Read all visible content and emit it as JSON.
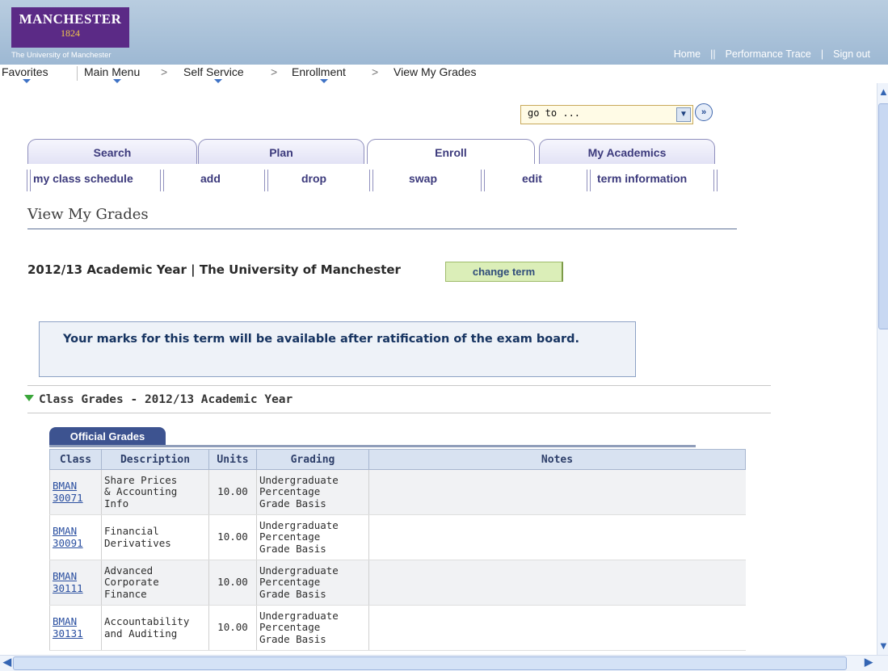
{
  "header": {
    "logo_name": "MANCHESTER",
    "logo_year": "1824",
    "logo_sub": "The University of Manchester",
    "links": [
      "Home",
      "Performance Trace",
      "Sign out"
    ]
  },
  "nav": {
    "items": [
      "Favorites",
      "Main Menu",
      "Self Service",
      "Enrollment",
      "View My Grades"
    ]
  },
  "goto": {
    "value": "go to ..."
  },
  "tabs": [
    "Search",
    "Plan",
    "Enroll",
    "My Academics"
  ],
  "active_tab": "Enroll",
  "subtabs": [
    "my class schedule",
    "add",
    "drop",
    "swap",
    "edit",
    "term information"
  ],
  "page": {
    "title": "View My Grades",
    "term": "2012/13 Academic Year | The University of Manchester",
    "change_term": "change term",
    "notice": "Your marks for this term will be available after ratification of the exam board.",
    "section_title": "Class Grades - 2012/13 Academic Year",
    "grades_tab": "Official Grades"
  },
  "table": {
    "headers": [
      "Class",
      "Description",
      "Units",
      "Grading",
      "Notes"
    ],
    "rows": [
      {
        "class_a": "BMAN",
        "class_b": "30071",
        "desc": [
          "Share Prices",
          "& Accounting",
          "Info"
        ],
        "units": "10.00",
        "grading": [
          "Undergraduate",
          "Percentage",
          "Grade Basis"
        ],
        "notes": ""
      },
      {
        "class_a": "BMAN",
        "class_b": "30091",
        "desc": [
          "Financial",
          "Derivatives"
        ],
        "units": "10.00",
        "grading": [
          "Undergraduate",
          "Percentage",
          "Grade Basis"
        ],
        "notes": ""
      },
      {
        "class_a": "BMAN",
        "class_b": "30111",
        "desc": [
          "Advanced",
          "Corporate",
          "Finance"
        ],
        "units": "10.00",
        "grading": [
          "Undergraduate",
          "Percentage",
          "Grade Basis"
        ],
        "notes": ""
      },
      {
        "class_a": "BMAN",
        "class_b": "30131",
        "desc": [
          "Accountability",
          "and Auditing"
        ],
        "units": "10.00",
        "grading": [
          "Undergraduate",
          "Percentage",
          "Grade Basis"
        ],
        "notes": ""
      }
    ]
  }
}
